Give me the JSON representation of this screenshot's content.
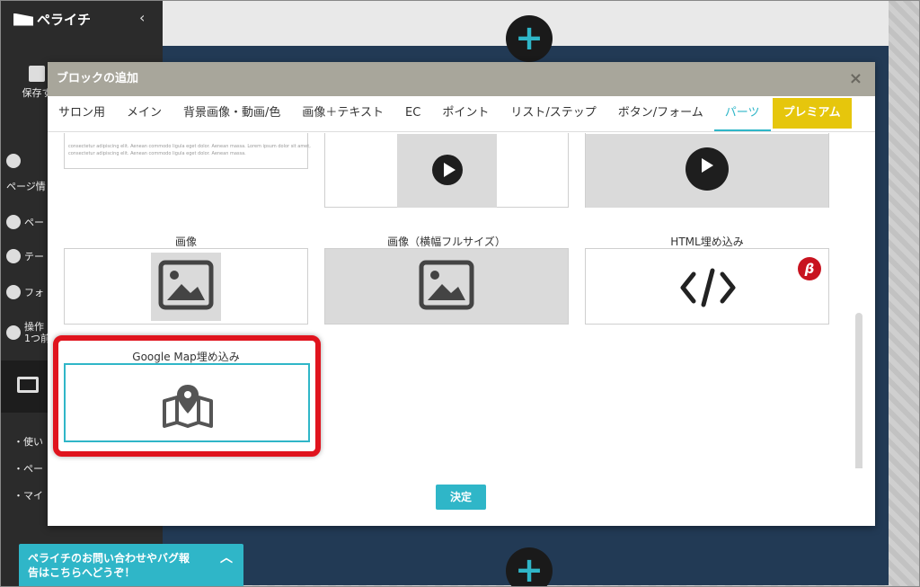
{
  "sidebar": {
    "logo": "ペライチ",
    "collapse_icon": "chevron-left-icon",
    "save_label": "保存す",
    "items": [
      {
        "icon": "gear-icon",
        "label": "ページ情"
      },
      {
        "icon": "wrench-icon",
        "label": "ペー"
      },
      {
        "icon": "palette-icon",
        "label": "テー"
      },
      {
        "icon": "font-icon",
        "label": "フォ"
      },
      {
        "icon": "undo-icon",
        "label": "操作\n1つ前"
      }
    ],
    "bullets": [
      "・使い",
      "・ペー",
      "・マイ"
    ]
  },
  "modal": {
    "title": "ブロックの追加",
    "close": "×",
    "tabs": [
      {
        "label": "サロン用"
      },
      {
        "label": "メイン"
      },
      {
        "label": "背景画像・動画/色"
      },
      {
        "label": "画像＋テキスト"
      },
      {
        "label": "EC"
      },
      {
        "label": "ポイント"
      },
      {
        "label": "リスト/ステップ"
      },
      {
        "label": "ボタン/フォーム"
      },
      {
        "label": "パーツ",
        "active": true
      },
      {
        "label": "プレミアム",
        "premium": true
      }
    ],
    "cards": {
      "image": "画像",
      "image_full": "画像（横幅フルサイズ）",
      "html_embed": "HTML埋め込み",
      "map_embed": "Google Map埋め込み",
      "beta_badge": "β"
    },
    "sample_text": "consectetur adipiscing elit. Aenean commodo ligula eget dolor. Aenean massa. Lorem ipsum dolor sit amet, consectetur adipiscing elit. Aenean commodo ligula eget dolor. Aenean massa.",
    "submit_label": "決定"
  },
  "chat_button": {
    "text": "ペライチのお問い合わせやバグ報告はこちらへどうぞ！",
    "line1": "ペライチのお問い合わせやバグ報",
    "line2": "告はこちらへどうぞ！",
    "icon": "chevron-up-icon"
  },
  "colors": {
    "accent": "#2fb6c8",
    "premium": "#e6c60c",
    "highlight": "#e0141e",
    "header": "#a8a69b"
  }
}
